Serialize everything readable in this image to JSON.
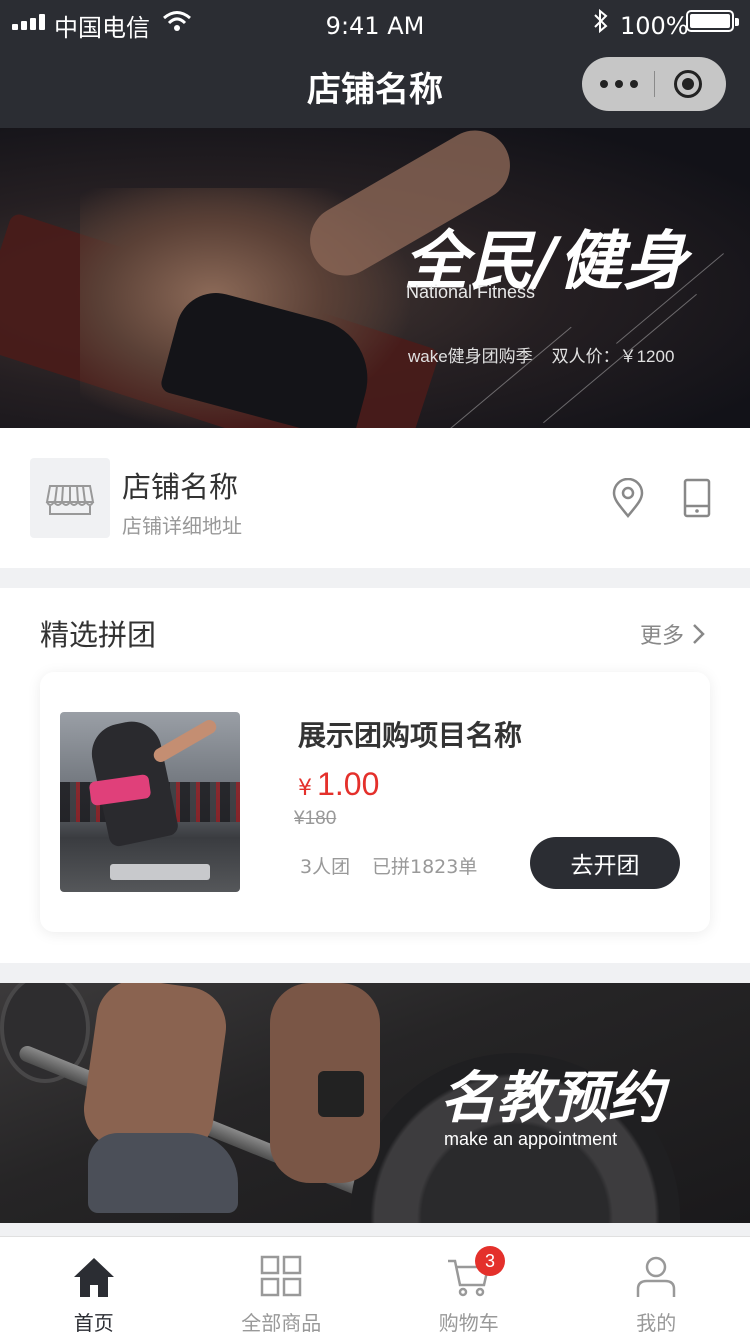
{
  "status_bar": {
    "carrier": "中国电信",
    "time": "9:41 AM",
    "battery": "100%"
  },
  "nav": {
    "title": "店铺名称"
  },
  "hero": {
    "title": "全民/健身",
    "subtitle": "National Fitness",
    "promo": "wake健身团购季    双人价：￥1200"
  },
  "store": {
    "name": "店铺名称",
    "address": "店铺详细地址"
  },
  "group_buy": {
    "section_title": "精选拼团",
    "more_label": "更多",
    "item": {
      "name": "展示团购项目名称",
      "currency": "¥",
      "price": "1.00",
      "original_price": "¥180",
      "group_size": "3人团",
      "sold": "已拼1823单",
      "button_label": "去开团"
    }
  },
  "coach_banner": {
    "title": "名教预约",
    "subtitle": "make an appointment"
  },
  "tabbar": {
    "tabs": [
      {
        "label": "首页",
        "icon": "home-icon",
        "active": true
      },
      {
        "label": "全部商品",
        "icon": "grid-icon",
        "active": false
      },
      {
        "label": "购物车",
        "icon": "cart-icon",
        "active": false
      },
      {
        "label": "我的",
        "icon": "user-icon",
        "active": false
      }
    ],
    "cart_badge": "3"
  },
  "colors": {
    "header_bg": "#2b2d33",
    "price_red": "#e4302b",
    "button_dark": "#2b2d33",
    "page_bg": "#f0f1f3"
  }
}
